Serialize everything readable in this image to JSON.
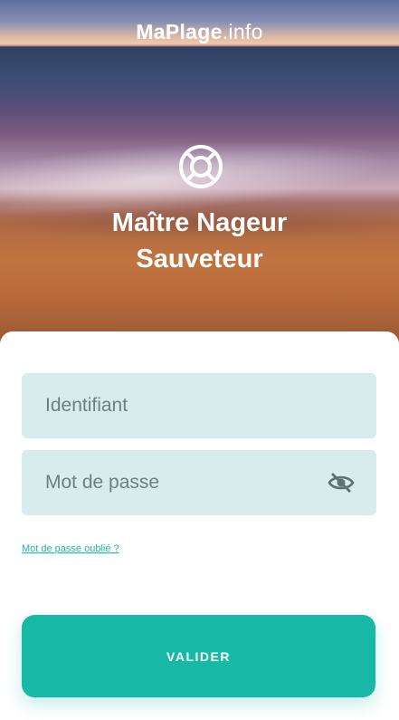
{
  "header": {
    "logo_brand": "MaPlage",
    "logo_tld": ".info",
    "title_line1": "Maître Nageur",
    "title_line2": "Sauveteur",
    "hero_icon": "lifebuoy-icon"
  },
  "form": {
    "username_placeholder": "Identifiant",
    "username_value": "",
    "password_placeholder": "Mot de passe",
    "password_value": "",
    "password_toggle_icon": "eye-off-icon",
    "forgot_label": "Mot de passe oublié ?",
    "submit_label": "VALIDER"
  },
  "colors": {
    "accent": "#17b8a6",
    "field_bg": "#d7ecec",
    "text_on_accent": "#ffffff"
  }
}
